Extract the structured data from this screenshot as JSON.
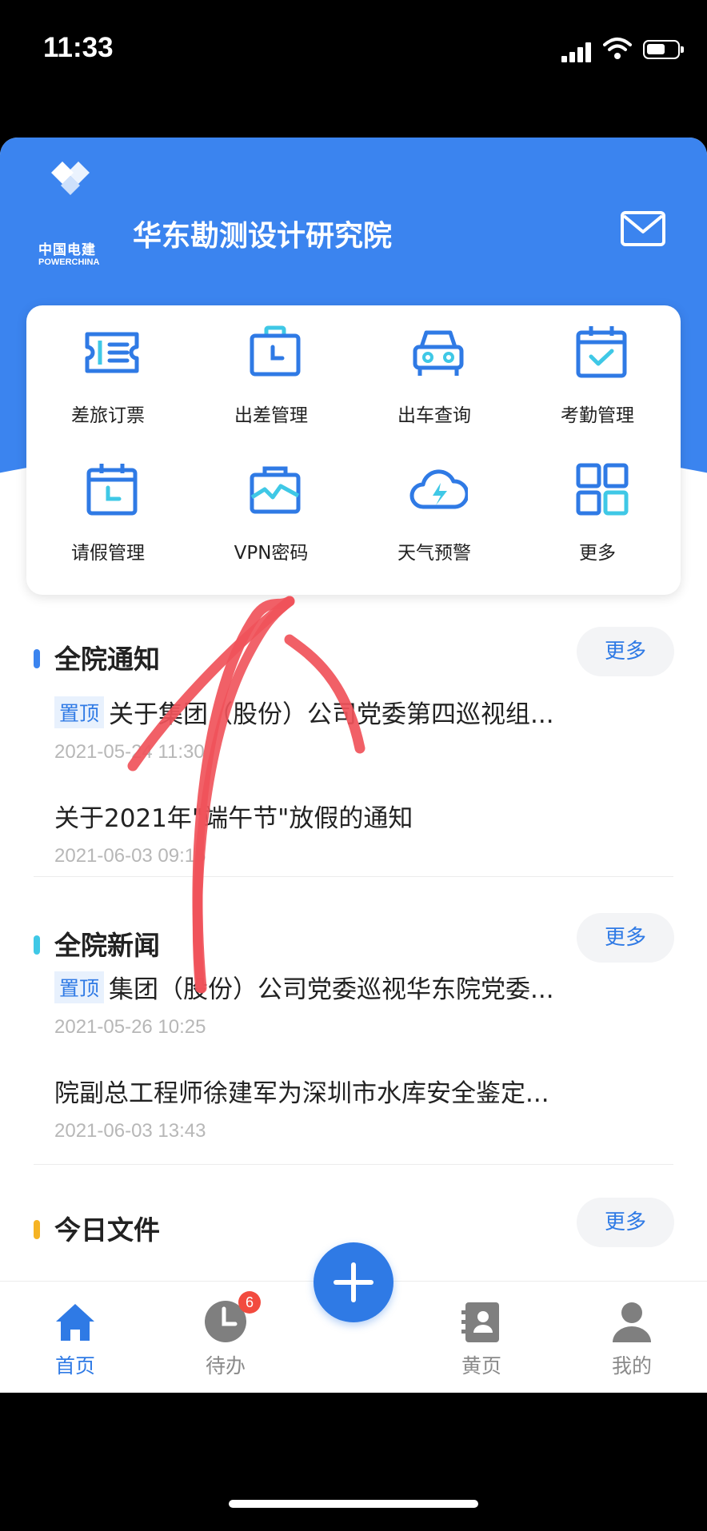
{
  "status_bar": {
    "time": "11:33"
  },
  "header": {
    "logo_cn": "中国电建",
    "logo_en": "POWERCHINA",
    "title": "华东勘测设计研究院",
    "icon": "mail-icon"
  },
  "quick_menu": [
    {
      "label": "差旅订票",
      "icon": "ticket-icon"
    },
    {
      "label": "出差管理",
      "icon": "briefcase-clock-icon"
    },
    {
      "label": "出车查询",
      "icon": "car-icon"
    },
    {
      "label": "考勤管理",
      "icon": "calendar-check-icon"
    },
    {
      "label": "请假管理",
      "icon": "calendar-clock-icon"
    },
    {
      "label": "VPN密码",
      "icon": "vpn-bag-icon"
    },
    {
      "label": "天气预警",
      "icon": "cloud-bolt-icon"
    },
    {
      "label": "更多",
      "icon": "grid-icon"
    }
  ],
  "sections": [
    {
      "title": "全院通知",
      "more": "更多",
      "accent": "#3b84ef",
      "items": [
        {
          "pinned": true,
          "pin_label": "置顶",
          "title": "关于集团（股份）公司党委第四巡视组...",
          "date": "2021-05-24 11:30"
        },
        {
          "pinned": false,
          "title": "关于2021年\"端午节\"放假的通知",
          "date": "2021-06-03 09:15"
        }
      ]
    },
    {
      "title": "全院新闻",
      "more": "更多",
      "accent": "#3fc8e6",
      "items": [
        {
          "pinned": true,
          "pin_label": "置顶",
          "title": "集团（股份）公司党委巡视华东院党委...",
          "date": "2021-05-26 10:25"
        },
        {
          "pinned": false,
          "title": "院副总工程师徐建军为深圳市水库安全鉴定...",
          "date": "2021-06-03 13:43"
        }
      ]
    },
    {
      "title": "今日文件",
      "more": "更多",
      "accent": "#f5b324",
      "items": []
    }
  ],
  "tab_bar": {
    "tabs": [
      {
        "label": "首页",
        "icon": "home-icon",
        "active": true
      },
      {
        "label": "待办",
        "icon": "clock-icon",
        "badge": "6"
      },
      {
        "label": "黄页",
        "icon": "contacts-book-icon"
      },
      {
        "label": "我的",
        "icon": "user-icon"
      }
    ],
    "fab_icon": "plus-icon"
  },
  "colors": {
    "brand": "#3b84ef",
    "accent": "#2f7ae5",
    "annotation": "#f0525a"
  }
}
